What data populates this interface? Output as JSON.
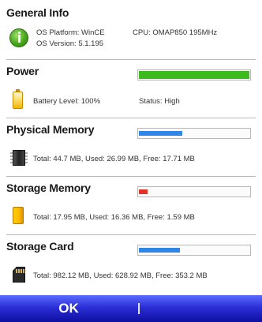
{
  "general_info": {
    "title": "General Info",
    "os_platform": "OS Platform: WinCE",
    "cpu": "CPU: OMAP850 195MHz",
    "os_version": "OS Version: 5.1.195"
  },
  "power": {
    "title": "Power",
    "battery_level": "Battery Level: 100%",
    "status": "Status: High",
    "level_fraction": 1.0
  },
  "physical_memory": {
    "title": "Physical Memory",
    "details": "Total: 44.7 MB, Used: 26.99 MB, Free: 17.71 MB",
    "used_fraction": 0.39
  },
  "storage_memory": {
    "title": "Storage Memory",
    "details": "Total: 17.95 MB, Used: 16.36 MB, Free: 1.59 MB",
    "used_fraction": 0.08
  },
  "storage_card": {
    "title": "Storage Card",
    "details": "Total: 982.12 MB, Used: 628.92 MB, Free: 353.2 MB",
    "used_fraction": 0.37
  },
  "menubar": {
    "left_softkey": "OK",
    "right_softkey": ""
  },
  "colors": {
    "power_bar": "#3dbb1e",
    "memory_bar": "#2f86e8",
    "storage_bar": "#e0362a",
    "menubar": "#2b2fd6"
  },
  "icons": {
    "general_info": "info-icon",
    "power": "battery-icon",
    "physical_memory": "memory-chip-icon",
    "storage_memory": "storage-folder-icon",
    "storage_card": "sd-card-icon"
  }
}
